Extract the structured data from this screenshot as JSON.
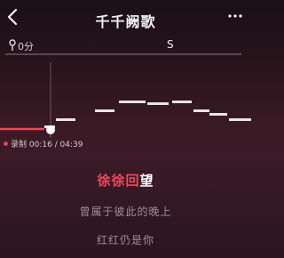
{
  "header": {
    "title": "千千阙歌",
    "back_icon": "chevron-left-icon",
    "more_icon": "more-horizontal-icon"
  },
  "score": {
    "icon": "score-icon",
    "value": "0分",
    "grade": "S"
  },
  "recording": {
    "label": "录制",
    "elapsed": "00:16",
    "total": "04:39",
    "display": "录制 00:16 / 04:39",
    "dot_color": "#e5405a"
  },
  "lyrics": {
    "current_sung": "徐徐回",
    "current_unsung": "望",
    "next": "曾属于彼此的晚上",
    "next2": "红红仍是你"
  },
  "colors": {
    "accent": "#f0485e",
    "note_bar": "#e8e4e6"
  }
}
